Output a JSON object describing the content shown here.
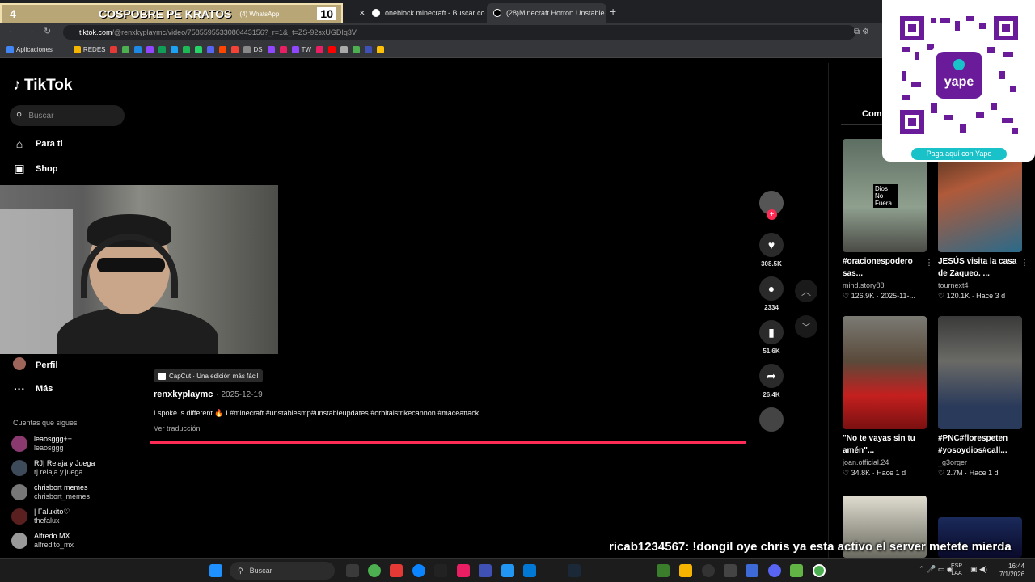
{
  "browser": {
    "overlay": {
      "left_count": "4",
      "title": "COSPOBRE PE KRATOS",
      "whatsapp": "(4) WhatsApp",
      "right_count": "10"
    },
    "tabs": [
      {
        "label": "oneblock minecraft - Buscar co"
      },
      {
        "label": "(28)Minecraft Horror: Unstable"
      }
    ],
    "url_host": "tiktok.com",
    "url_path": "/@renxkyplaymc/video/7585595533080443156?_r=1&_t=ZS-92sxUGDIq3V",
    "bookmarks": [
      {
        "label": "Aplicaciones",
        "color": "#4285f4"
      },
      {
        "label": "REDES",
        "color": "#f4b400"
      },
      {
        "label": "DS",
        "color": "#888888"
      },
      {
        "label": "TW",
        "color": "#9146ff"
      }
    ]
  },
  "sidebar": {
    "logo": "TikTok",
    "search_placeholder": "Buscar",
    "nav": [
      {
        "label": "Para ti",
        "icon": "home-icon"
      },
      {
        "label": "Shop",
        "icon": "shop-icon"
      },
      {
        "label": "Perfil",
        "icon": "profile-icon"
      },
      {
        "label": "Más",
        "icon": "more-icon"
      }
    ],
    "following_title": "Cuentas que sigues",
    "following": [
      {
        "name": "leaosggg++",
        "user": "leaosggg"
      },
      {
        "name": "RJ| Relaja y Juega",
        "user": "rj.relaja.y.juega"
      },
      {
        "name": "chrisbort memes",
        "user": "chrisbort_memes"
      },
      {
        "name": "| Faluxito♡",
        "user": "thefalux"
      },
      {
        "name": "Alfredo MX",
        "user": "alfredito_mx"
      }
    ]
  },
  "video": {
    "capcut": "CapCut · Una edición más fácil",
    "author": "renxkyplaymc",
    "date": "· 2025-12-19",
    "caption": "I spoke is different 🔥 I #minecraft #unstablesmp#unstableupdates #orbitalstrikecannon #maceattack ...",
    "translate": "Ver traducción",
    "likes": "308.5K",
    "comments": "2334",
    "saves": "51.6K",
    "shares": "26.4K"
  },
  "right_panel": {
    "tab": "Come",
    "cards": [
      {
        "title": "#oracionespodero sas...",
        "user": "mind.story88",
        "meta": "♡ 126.9K · 2025-11-...",
        "overlay": "Dios No Fuera"
      },
      {
        "title": "JESÚS visita la casa de Zaqueo. ...",
        "user": "tournext4",
        "meta": "♡ 120.1K · Hace 3 d"
      },
      {
        "title": "\"No te vayas sin tu amén\"...",
        "user": "joan.official.24",
        "meta": "♡ 34.8K · Hace 1 d"
      },
      {
        "title": "#PNC#florespeten #yosoydios#call...",
        "user": "_g3orger",
        "meta": "♡ 2.7M · Hace 1 d"
      }
    ]
  },
  "qr": {
    "brand": "yape",
    "label": "Paga aquí con Yape"
  },
  "chat": {
    "user": "ricab1234567:",
    "message": "!dongil oye chris ya esta activo el server metete mierda"
  },
  "taskbar": {
    "search": "Buscar",
    "lang": "ESP",
    "region": "LAA",
    "time": "16:44",
    "date": "7/1/2026"
  }
}
